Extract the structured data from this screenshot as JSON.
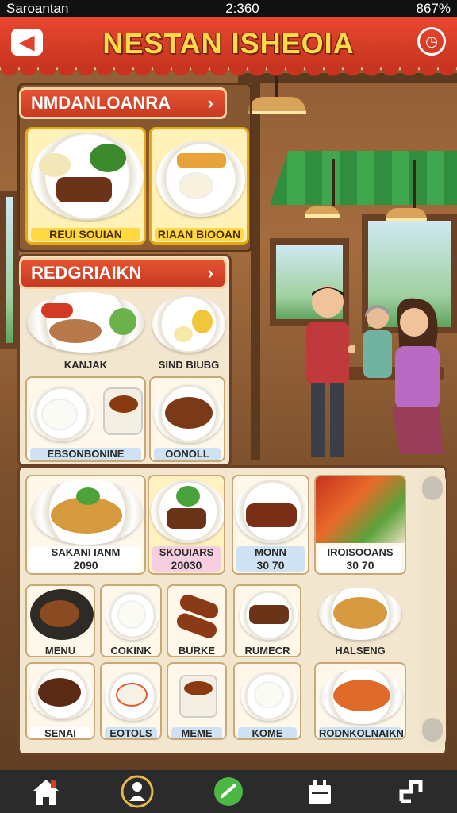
{
  "status": {
    "carrier": "Saroantan",
    "time": "2:360",
    "battery": "867%"
  },
  "header": {
    "title": "NESTAN ISHEOIA"
  },
  "section1": {
    "title": "NMDANLOANRA",
    "cards": [
      {
        "label": "REUI SOUIAN"
      },
      {
        "label": "RIAAN BIOOAN"
      }
    ]
  },
  "section2": {
    "title": "REDGRIAIKN",
    "cards": [
      {
        "label": "KANJAK"
      },
      {
        "label": "SIND BIUBG"
      },
      {
        "label": "EBSONBONINE"
      },
      {
        "label": "OONOLL"
      }
    ]
  },
  "menu": {
    "featured": [
      {
        "label": "SAKANI IANM",
        "price": "2090"
      },
      {
        "label": "SKOUIARS",
        "price": "20030"
      },
      {
        "label": "MONN",
        "price": "30 70"
      },
      {
        "label": "IROISOOANS",
        "price": "30 70"
      }
    ],
    "row2": [
      {
        "label": "MENU"
      },
      {
        "label": "COKINK"
      },
      {
        "label": "BURKE"
      },
      {
        "label": "RUMECR"
      },
      {
        "label": "HALSENG"
      }
    ],
    "row3": [
      {
        "label": "SENAI"
      },
      {
        "label": "EOTOLS"
      },
      {
        "label": "MEME"
      },
      {
        "label": "KOME"
      },
      {
        "label": "RODNKOLNAIKN"
      }
    ]
  },
  "icons": {
    "back": "back-arrow-icon",
    "clock": "clock-icon",
    "home": "home-icon",
    "profile": "profile-icon",
    "confirm": "confirm-icon",
    "shop": "shop-icon",
    "share": "share-icon"
  },
  "colors": {
    "header": "#d93c25",
    "title": "#ffd94a",
    "panel": "#f3e6cf"
  }
}
